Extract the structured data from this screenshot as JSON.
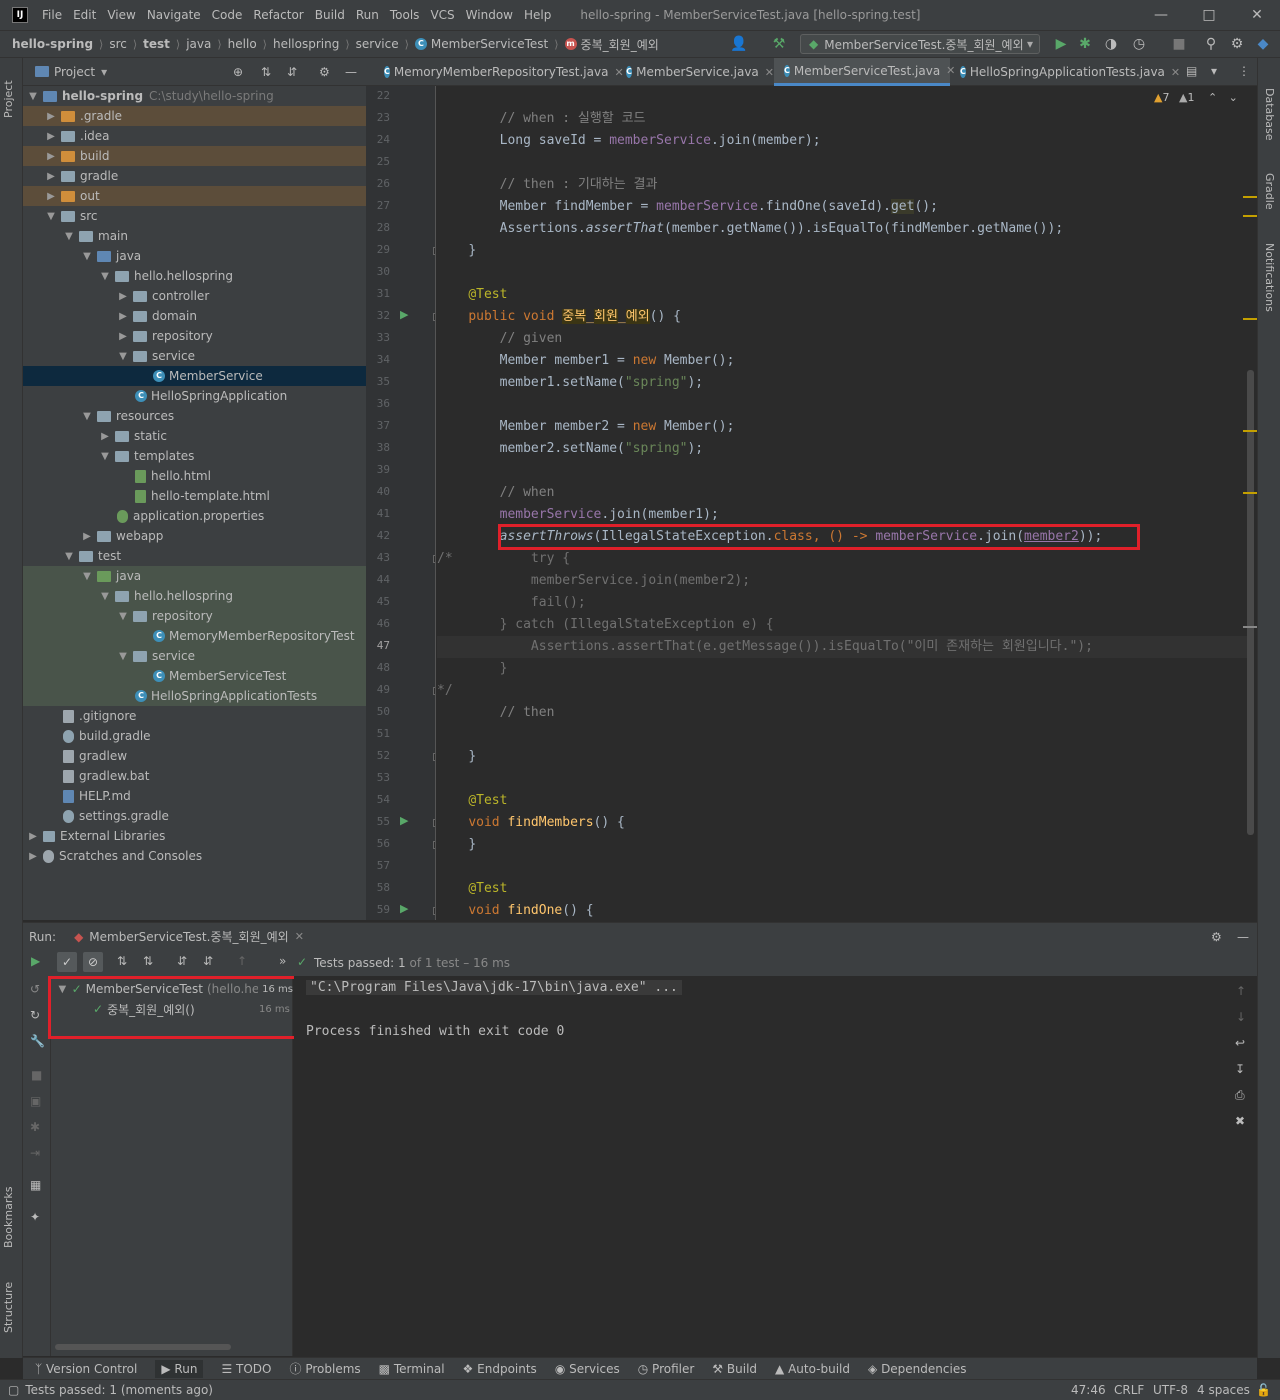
{
  "titlebar": {
    "menu": [
      "File",
      "Edit",
      "View",
      "Navigate",
      "Code",
      "Refactor",
      "Build",
      "Run",
      "Tools",
      "VCS",
      "Window",
      "Help"
    ],
    "title": "hello-spring - MemberServiceTest.java [hello-spring.test]"
  },
  "breadcrumbs": [
    "hello-spring",
    "src",
    "test",
    "java",
    "hello",
    "hellospring",
    "service",
    "MemberServiceTest",
    "중복_회원_예외"
  ],
  "run_config": "MemberServiceTest.중복_회원_예외",
  "project": {
    "title": "Project",
    "root_name": "hello-spring",
    "root_path": "C:\\study\\hello-spring",
    "items": [
      ".gradle",
      ".idea",
      "build",
      "gradle",
      "out",
      "src",
      "main",
      "java",
      "hello.hellospring",
      "controller",
      "domain",
      "repository",
      "service",
      "MemberService",
      "HelloSpringApplication",
      "resources",
      "static",
      "templates",
      "hello.html",
      "hello-template.html",
      "application.properties",
      "webapp",
      "test",
      "java",
      "hello.hellospring",
      "repository",
      "MemoryMemberRepositoryTest",
      "service",
      "MemberServiceTest",
      "HelloSpringApplicationTests",
      ".gitignore",
      "build.gradle",
      "gradlew",
      "gradlew.bat",
      "HELP.md",
      "settings.gradle",
      "External Libraries",
      "Scratches and Consoles"
    ]
  },
  "tabs": [
    "MemoryMemberRepositoryTest.java",
    "MemberService.java",
    "MemberServiceTest.java",
    "HelloSpringApplicationTests.java"
  ],
  "inspections": {
    "warnings": "7",
    "weak": "1"
  },
  "code": {
    "line_numbers": [
      "22",
      "23",
      "24",
      "25",
      "26",
      "27",
      "28",
      "29",
      "30",
      "31",
      "32",
      "33",
      "34",
      "35",
      "36",
      "37",
      "38",
      "39",
      "40",
      "41",
      "42",
      "43",
      "44",
      "45",
      "46",
      "47",
      "48",
      "49",
      "50",
      "51",
      "52",
      "53",
      "54",
      "55",
      "56",
      "57",
      "58",
      "59"
    ],
    "l23": "// when : 실행할 코드",
    "l24a": "Long saveId = ",
    "l24b": "memberService",
    "l24c": ".join(member);",
    "l26": "// then : 기대하는 결과",
    "l27a": "Member findMember = ",
    "l27b": "memberService",
    "l27c": ".findOne(saveId).",
    "l27d": "get",
    "l27e": "();",
    "l28a": "Assertions.",
    "l28b": "assertThat",
    "l28c": "(member.getName()).isEqualTo(findMember.getName());",
    "l29": "}",
    "l31": "@Test",
    "l32a": "public void ",
    "l32b": "중복",
    "l32c": "_",
    "l32d": "회원",
    "l32e": "_",
    "l32f": "예외",
    "l32g": "() {",
    "l33": "// given",
    "l34a": "Member member1 = ",
    "l34b": "new ",
    "l34c": "Member();",
    "l35a": "member1.setName(",
    "l35b": "\"spring\"",
    "l35c": ");",
    "l37a": "Member member2 = ",
    "l37b": "new ",
    "l37c": "Member();",
    "l38a": "member2.setName(",
    "l38b": "\"spring\"",
    "l38c": ");",
    "l40": "// when",
    "l41a": "memberService",
    "l41b": ".join(member1);",
    "l42a": "assertThrows",
    "l42b": "(IllegalStateException.",
    "l42c": "class",
    "l42d": ", () -> ",
    "l42e": "memberService",
    "l42f": ".join(",
    "l42g": "member2",
    "l42h": "));",
    "l43": "/*",
    "l43b": "try {",
    "l44": "memberService.join(member2);",
    "l45": "fail();",
    "l46": "} catch (IllegalStateException e) {",
    "l47": "Assertions.assertThat(e.getMessage()).isEqualTo(\"이미 존재하는 회원입니다.\");",
    "l48": "}",
    "l49": "*/",
    "l50": "// then",
    "l52": "}",
    "l54": "@Test",
    "l55a": "void ",
    "l55b": "findMembers",
    "l55c": "() {",
    "l56": "}",
    "l58": "@Test",
    "l59a": "void ",
    "l59b": "findOne",
    "l59c": "() {"
  },
  "run": {
    "label": "Run:",
    "tab": "MemberServiceTest.중복_회원_예외",
    "status_prefix": "Tests passed:",
    "status_count": "1",
    "status_rest": "of 1 test – 16 ms",
    "suite_name": "MemberServiceTest",
    "suite_pkg": "(hello.hello",
    "suite_time": "16 ms",
    "test_name": "중복_회원_예외()",
    "test_time": "16 ms",
    "console": [
      "\"C:\\Program Files\\Java\\jdk-17\\bin\\java.exe\" ...",
      "Process finished with exit code 0"
    ]
  },
  "toolwindows": [
    "Version Control",
    "Run",
    "TODO",
    "Problems",
    "Terminal",
    "Endpoints",
    "Services",
    "Profiler",
    "Build",
    "Auto-build",
    "Dependencies"
  ],
  "side_tabs": {
    "project": "Project",
    "bookmarks": "Bookmarks",
    "structure": "Structure",
    "database": "Database",
    "gradle": "Gradle",
    "notifications": "Notifications"
  },
  "statusbar": {
    "message": "Tests passed: 1 (moments ago)",
    "position": "47:46",
    "line_sep": "CRLF",
    "encoding": "UTF-8",
    "indent": "4 spaces"
  },
  "colors": {
    "accent": "#4a88c7",
    "highlight_box": "#e0202a",
    "pass_green": "#59a869"
  }
}
